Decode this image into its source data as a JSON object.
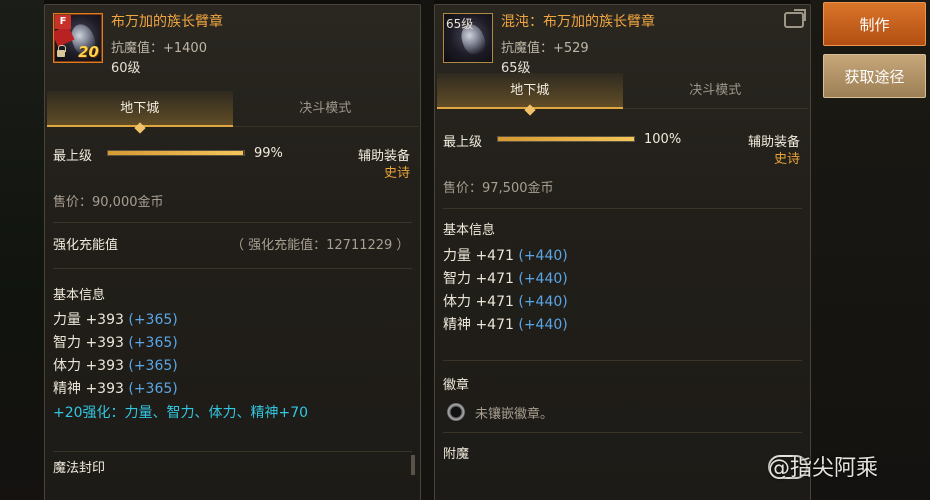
{
  "left_panel": {
    "item_name": "布万加的族长臂章",
    "icon": {
      "badge": "F",
      "plus": "20",
      "name": "armband-icon"
    },
    "magic_resist": "抗魔值：+1400",
    "level": "60级",
    "tabs": [
      {
        "label": "地下城",
        "active": true
      },
      {
        "label": "决斗模式",
        "active": false
      }
    ],
    "grade_label": "最上级",
    "grade_percent": "99%",
    "grade_fill": 0.99,
    "slot_label": "辅助装备",
    "rarity": "史诗",
    "price": "售价：90,000金币",
    "enhance_label": "强化充能值",
    "enhance_value": "（ 强化充能值：12711229 ）",
    "basic_info_title": "基本信息",
    "stats": [
      {
        "name": "力量 +393",
        "bonus": "(+365)"
      },
      {
        "name": "智力 +393",
        "bonus": "(+365)"
      },
      {
        "name": "体力 +393",
        "bonus": "(+365)"
      },
      {
        "name": "精神 +393",
        "bonus": "(+365)"
      }
    ],
    "enhance_bonus": "+20强化：力量、智力、体力、精神+70",
    "cut_off_text": "魔法封印"
  },
  "right_panel": {
    "item_name": "混沌：布万加的族长臂章",
    "icon": {
      "level": "65级",
      "name": "armband-icon"
    },
    "magic_resist": "抗魔值：+529",
    "level": "65级",
    "tabs": [
      {
        "label": "地下城",
        "active": true
      },
      {
        "label": "决斗模式",
        "active": false
      }
    ],
    "grade_label": "最上级",
    "grade_percent": "100%",
    "grade_fill": 1.0,
    "slot_label": "辅助装备",
    "rarity": "史诗",
    "price": "售价：97,500金币",
    "basic_info_title": "基本信息",
    "stats": [
      {
        "name": "力量 +471",
        "bonus": "(+440)"
      },
      {
        "name": "智力 +471",
        "bonus": "(+440)"
      },
      {
        "name": "体力 +471",
        "bonus": "(+440)"
      },
      {
        "name": "精神 +471",
        "bonus": "(+440)"
      }
    ],
    "emblem_title": "徽章",
    "emblem_text": "未镶嵌徽章。",
    "enchant_title": "附魔"
  },
  "side_buttons": {
    "make": "制作",
    "obtain": "获取途径"
  },
  "watermark": "@指尖阿乘",
  "colors": {
    "item_name": "#f0a640",
    "rarity": "#e8a339",
    "bonus": "#5aa6e6",
    "enhance": "#32c6e0",
    "button_make": "#c9621e",
    "button_get": "#b0926a"
  }
}
